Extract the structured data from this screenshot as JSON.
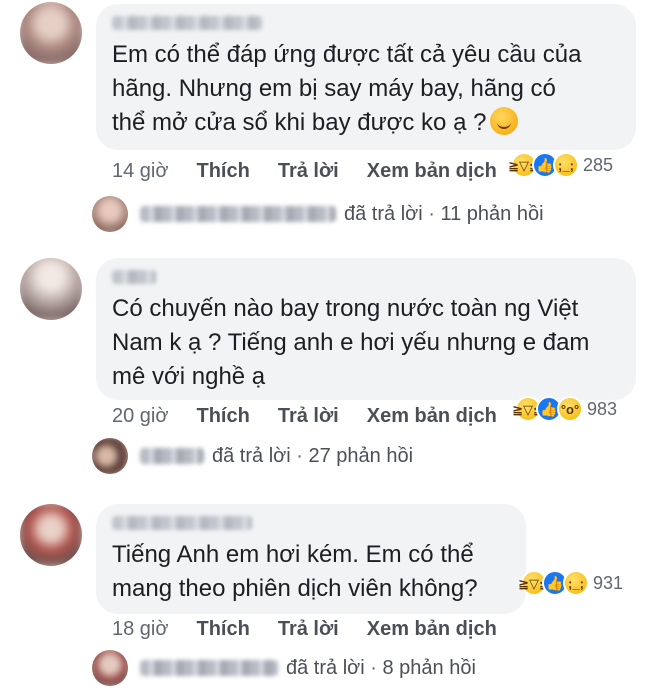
{
  "comments": [
    {
      "text_line1": "Em có thể đáp ứng được tất cả yêu cầu của",
      "text_line2": "hãng. Nhưng em bị say máy bay, hãng có",
      "text_line3": "thể mở cửa sổ khi bay được ko ạ ?",
      "time": "14 giờ",
      "like": "Thích",
      "reply": "Trả lời",
      "translate": "Xem bản dịch",
      "reactions": [
        "haha",
        "like",
        "sad"
      ],
      "reaction_count": "285",
      "replied": "đã trả lời",
      "reply_count": "11 phản hồi"
    },
    {
      "text_line1": "Có chuyến nào bay trong nước toàn ng Việt",
      "text_line2": "Nam k ạ ? Tiếng anh e hơi yếu nhưng e đam",
      "text_line3": "mê với nghề ạ",
      "time": "20 giờ",
      "like": "Thích",
      "reply": "Trả lời",
      "translate": "Xem bản dịch",
      "reactions": [
        "haha",
        "like",
        "wow"
      ],
      "reaction_count": "983",
      "replied": "đã trả lời",
      "reply_count": "27 phản hồi"
    },
    {
      "text_line1": "Tiếng Anh em hơi kém. Em có thể",
      "text_line2": "mang theo phiên dịch viên không?",
      "time": "18 giờ",
      "like": "Thích",
      "reply": "Trả lời",
      "translate": "Xem bản dịch",
      "reactions": [
        "haha",
        "like",
        "sad"
      ],
      "reaction_count": "931",
      "replied": "đã trả lời",
      "reply_count": "8 phản hồi"
    }
  ],
  "icons": {
    "haha": "laughing-face-icon",
    "like": "thumbs-up-icon",
    "sad": "crying-face-icon",
    "wow": "surprised-face-icon",
    "hug": "hugging-face-icon"
  },
  "colors": {
    "bubble": "#f2f3f5",
    "like_blue": "#1877f2",
    "meta_text": "#606770"
  }
}
